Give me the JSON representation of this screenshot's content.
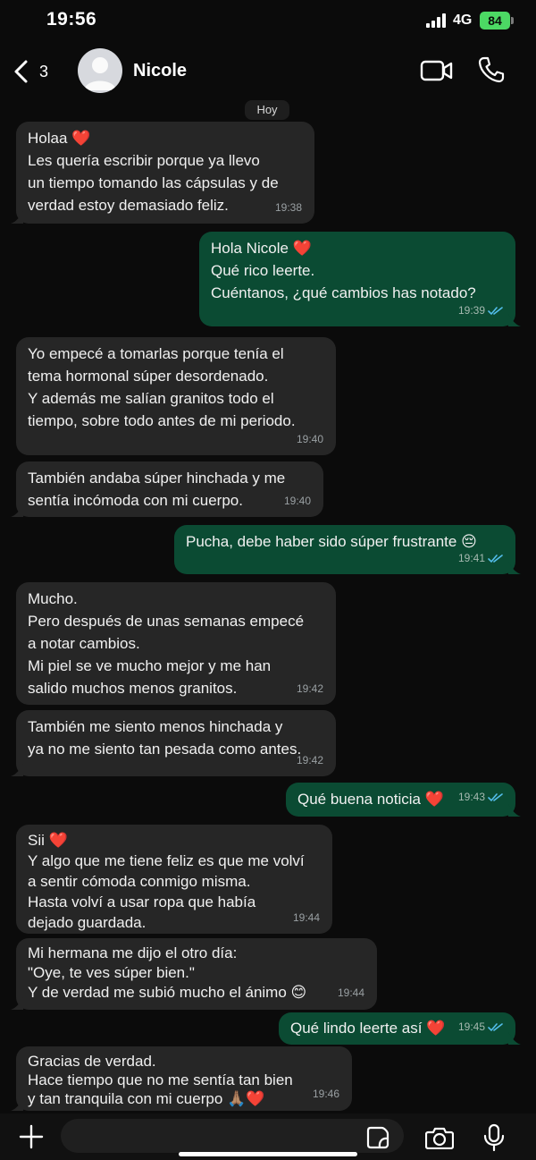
{
  "status_bar": {
    "time": "19:56",
    "network": "4G",
    "battery": "84"
  },
  "header": {
    "back_count": "3",
    "contact_name": "Nicole"
  },
  "chat": {
    "date_label": "Hoy",
    "messages": [
      {
        "direction": "in",
        "lines": [
          "Holaa ❤️",
          "Les quería escribir porque ya llevo",
          "un tiempo tomando las cápsulas y de",
          "verdad estoy demasiado feliz."
        ],
        "time": "19:38"
      },
      {
        "direction": "out",
        "lines": [
          "Hola Nicole ❤️",
          "Qué rico leerte.",
          "Cuéntanos, ¿qué cambios has notado?"
        ],
        "time": "19:39",
        "status": "read"
      },
      {
        "direction": "in",
        "lines": [
          "Yo empecé a tomarlas porque tenía el",
          "tema hormonal súper desordenado.",
          "Y además me salían granitos todo el",
          "tiempo, sobre todo antes de mi periodo."
        ],
        "time": "19:40"
      },
      {
        "direction": "in",
        "lines": [
          "También andaba súper hinchada y me",
          "sentía incómoda con mi cuerpo."
        ],
        "time": "19:40"
      },
      {
        "direction": "out",
        "lines": [
          "Pucha, debe haber sido súper frustrante 😔"
        ],
        "time": "19:41",
        "status": "read"
      },
      {
        "direction": "in",
        "lines": [
          "Mucho.",
          "Pero después de unas semanas empecé",
          "a notar cambios.",
          "Mi piel se ve mucho mejor y me han",
          "salido muchos menos granitos."
        ],
        "time": "19:42"
      },
      {
        "direction": "in",
        "lines": [
          "También me siento menos hinchada y",
          "ya no me siento tan pesada como antes."
        ],
        "time": "19:42"
      },
      {
        "direction": "out",
        "lines": [
          "Qué buena noticia ❤️"
        ],
        "time": "19:43",
        "status": "read"
      },
      {
        "direction": "in",
        "lines": [
          "Sii ❤️",
          "Y algo que me tiene feliz es que me volví",
          "a sentir cómoda conmigo misma.",
          "Hasta volví a usar ropa que había",
          "dejado guardada."
        ],
        "time": "19:44"
      },
      {
        "direction": "in",
        "lines": [
          "Mi hermana me dijo el otro día:",
          "\"Oye, te ves súper bien.\"",
          "Y de verdad me subió mucho el ánimo 😊"
        ],
        "time": "19:44"
      },
      {
        "direction": "out",
        "lines": [
          "Qué lindo leerte así ❤️"
        ],
        "time": "19:45",
        "status": "read"
      },
      {
        "direction": "in",
        "lines": [
          "Gracias de verdad.",
          "Hace tiempo que no me sentía tan bien",
          "y tan tranquila con mi cuerpo 🙏🏽❤️"
        ],
        "time": "19:46"
      }
    ]
  },
  "input_bar": {
    "placeholder": ""
  },
  "colors": {
    "incoming_bubble": "#262626",
    "outgoing_bubble": "#0b4b33",
    "read_ticks": "#53bdeb",
    "battery": "#4cd964"
  },
  "icons": [
    "back-chevron-icon",
    "avatar-placeholder-icon",
    "video-camera-icon",
    "phone-icon",
    "plus-icon",
    "sticker-icon",
    "camera-icon",
    "microphone-icon",
    "signal-bars-icon",
    "double-check-icon"
  ]
}
